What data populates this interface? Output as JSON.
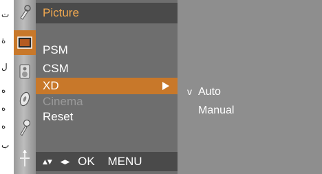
{
  "page_edge_glyphs": [
    "ت",
    "ة",
    "ل",
    "ه",
    "ه",
    "ه",
    "ب"
  ],
  "sidebar": {
    "icons": [
      {
        "name": "setup-wrench-icon"
      },
      {
        "name": "picture-screen-icon"
      },
      {
        "name": "audio-speaker-icon"
      },
      {
        "name": "time-disc-icon"
      },
      {
        "name": "option-key-icon"
      },
      {
        "name": "screen-adjust-icon"
      }
    ]
  },
  "menu": {
    "title": "Picture",
    "items": [
      {
        "label": "PSM"
      },
      {
        "label": "CSM"
      },
      {
        "label": "XD"
      },
      {
        "label": "Cinema"
      },
      {
        "label": "Reset"
      }
    ],
    "footer": {
      "updown_glyph": "▲▼",
      "leftright_glyph": "◀▶",
      "ok": "OK",
      "menu": "MENU"
    }
  },
  "submenu": {
    "check_mark": "v",
    "options": [
      {
        "label": "Auto"
      },
      {
        "label": "Manual"
      }
    ]
  },
  "colors": {
    "highlight": "#c8782a",
    "title_text": "#f0a850",
    "disabled_text": "#9a9a9a",
    "panel_bg": "#6e6e6e",
    "sub_bg": "#8e8e8e"
  }
}
